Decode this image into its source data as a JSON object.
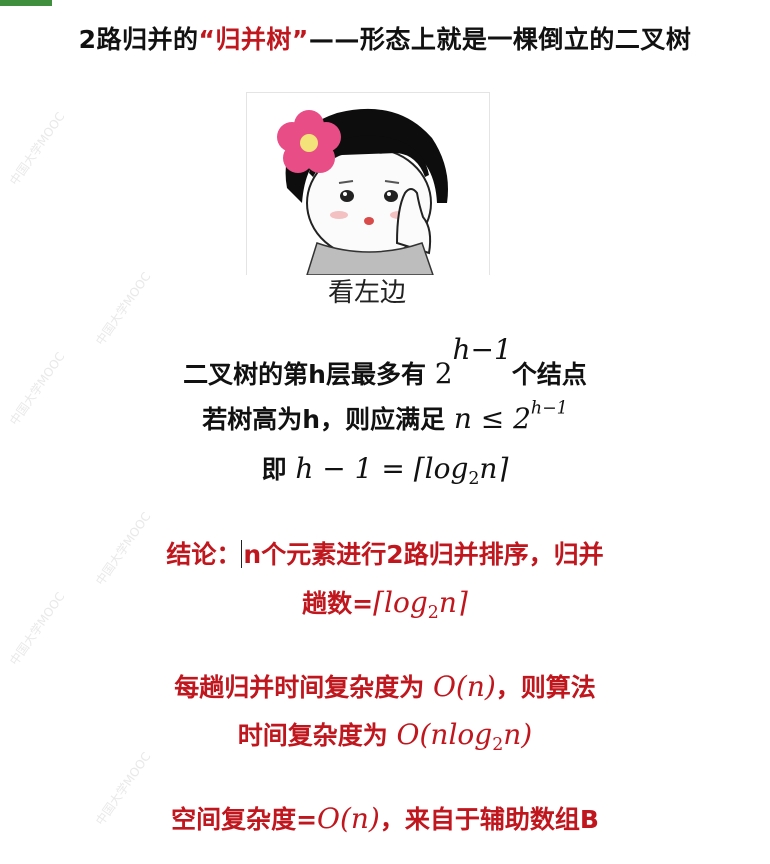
{
  "title": {
    "prefix": "2路归并的",
    "highlight": "“归并树”",
    "suffix": "——形态上就是一棵倒立的二叉树"
  },
  "meme": {
    "caption": "看左边",
    "icon": "girl-with-flower-pointing-left"
  },
  "facts": {
    "line1_text": "二叉树的第h层最多有",
    "line1_math_base": "2",
    "line1_math_sup": "h−1",
    "line1_tail": "个结点",
    "line2_text": "若树高为h，则应满足",
    "line2_math_n": "n ≤ 2",
    "line2_math_sup": "h−1",
    "line3_text": "即",
    "line3_math_left": "h − 1 = ⌈log",
    "line3_math_sub": "2",
    "line3_math_right": "n⌉"
  },
  "conclusion": {
    "label": "结论：",
    "line1": "n个元素进行2路归并排序，归并",
    "line2_text": "趟数=",
    "line2_math_left": "⌈log",
    "line2_math_sub": "2",
    "line2_math_right": "n⌉"
  },
  "complexity": {
    "line1_text": "每趟归并时间复杂度为",
    "line1_math": "O(n)",
    "line1_tail": "，则算法",
    "line2_text": "时间复杂度为",
    "line2_math_left": "O(nlog",
    "line2_math_sub": "2",
    "line2_math_right": "n)"
  },
  "space": {
    "text": "空间复杂度=",
    "math": "O(n)",
    "tail": "，来自于辅助数组B"
  },
  "watermark": "中国大学MOOC",
  "colors": {
    "accent_red": "#c0161d",
    "tab_green": "#3f8f3f"
  }
}
